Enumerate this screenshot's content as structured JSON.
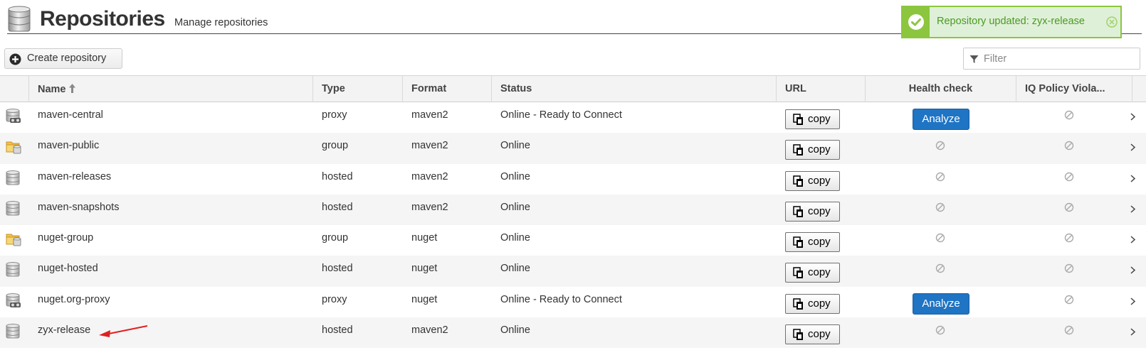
{
  "header": {
    "title": "Repositories",
    "subtitle": "Manage repositories",
    "icon": "database-icon"
  },
  "toast": {
    "message": "Repository updated: zyx-release",
    "color": "#8cc63f"
  },
  "toolbar": {
    "create_label": "Create repository",
    "filter_placeholder": "Filter"
  },
  "columns": [
    "Name",
    "Type",
    "Format",
    "Status",
    "URL",
    "Health check",
    "IQ Policy Viola..."
  ],
  "copy_label": "copy",
  "analyze_label": "Analyze",
  "rows": [
    {
      "name": "maven-central",
      "type": "proxy",
      "format": "maven2",
      "status": "Online - Ready to Connect",
      "health": "analyze",
      "icon": "proxy-repo-icon"
    },
    {
      "name": "maven-public",
      "type": "group",
      "format": "maven2",
      "status": "Online",
      "health": "na",
      "icon": "group-repo-icon"
    },
    {
      "name": "maven-releases",
      "type": "hosted",
      "format": "maven2",
      "status": "Online",
      "health": "na",
      "icon": "hosted-repo-icon"
    },
    {
      "name": "maven-snapshots",
      "type": "hosted",
      "format": "maven2",
      "status": "Online",
      "health": "na",
      "icon": "hosted-repo-icon"
    },
    {
      "name": "nuget-group",
      "type": "group",
      "format": "nuget",
      "status": "Online",
      "health": "na",
      "icon": "group-repo-icon"
    },
    {
      "name": "nuget-hosted",
      "type": "hosted",
      "format": "nuget",
      "status": "Online",
      "health": "na",
      "icon": "hosted-repo-icon"
    },
    {
      "name": "nuget.org-proxy",
      "type": "proxy",
      "format": "nuget",
      "status": "Online - Ready to Connect",
      "health": "analyze",
      "icon": "proxy-repo-icon"
    },
    {
      "name": "zyx-release",
      "type": "hosted",
      "format": "maven2",
      "status": "Online",
      "health": "na",
      "icon": "hosted-repo-icon"
    }
  ],
  "colors": {
    "accent_blue": "#1f74c4",
    "success_green": "#8cc63f",
    "annotation_red": "#e02020"
  }
}
